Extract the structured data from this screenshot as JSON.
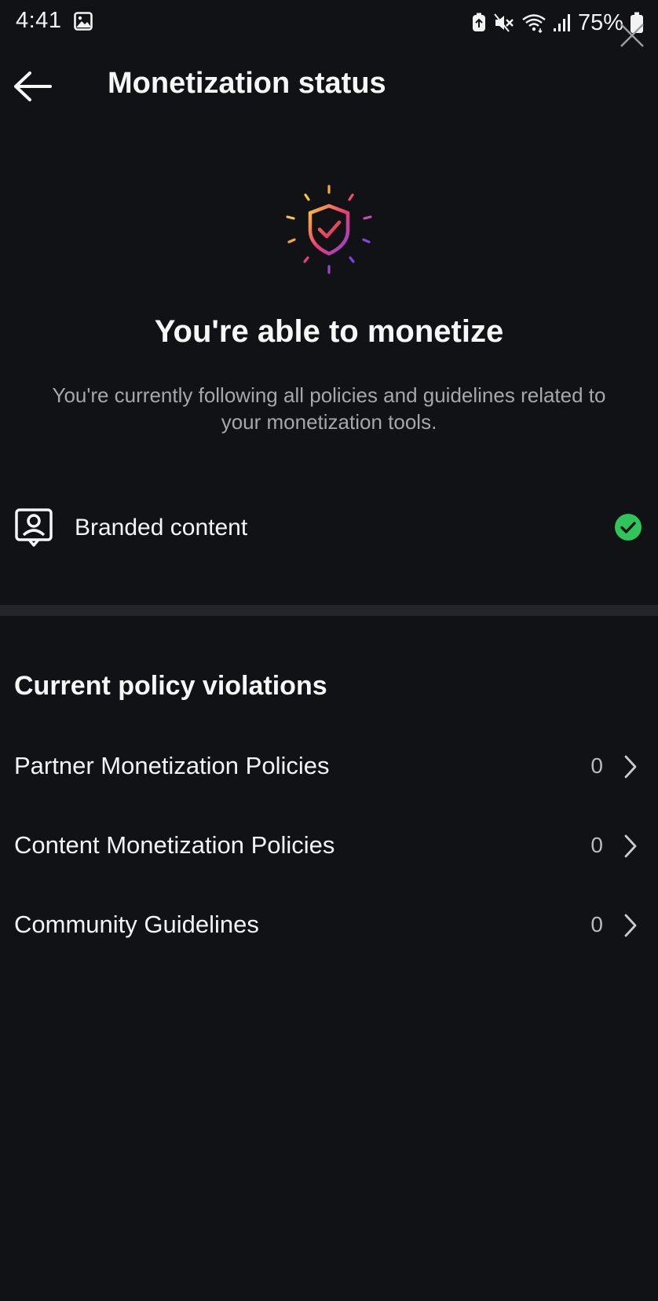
{
  "status_bar": {
    "time": "4:41",
    "battery": "75%",
    "icons": [
      "gallery-icon",
      "battery-saver-icon",
      "mute-icon",
      "wifi-icon",
      "signal-icon",
      "battery-icon"
    ]
  },
  "header": {
    "title": "Monetization status",
    "back_icon": "back-arrow-icon"
  },
  "hero": {
    "icon": "shield-check-icon",
    "title": "You're able to monetize",
    "description": "You're currently following all policies and guidelines related to your monetization tools."
  },
  "branded_content": {
    "label": "Branded content",
    "icon": "branded-content-icon",
    "status_icon": "check-circle-icon",
    "status_color": "#2fc55a"
  },
  "violations": {
    "title": "Current policy violations",
    "items": [
      {
        "label": "Partner Monetization Policies",
        "count": "0"
      },
      {
        "label": "Content Monetization Policies",
        "count": "0"
      },
      {
        "label": "Community Guidelines",
        "count": "0"
      }
    ]
  },
  "colors": {
    "background": "#111216",
    "divider": "#23252b",
    "secondary_text": "#a5a7ad",
    "accent_gradient": [
      "#f9c440",
      "#ef3e6a",
      "#8a43e0"
    ]
  }
}
